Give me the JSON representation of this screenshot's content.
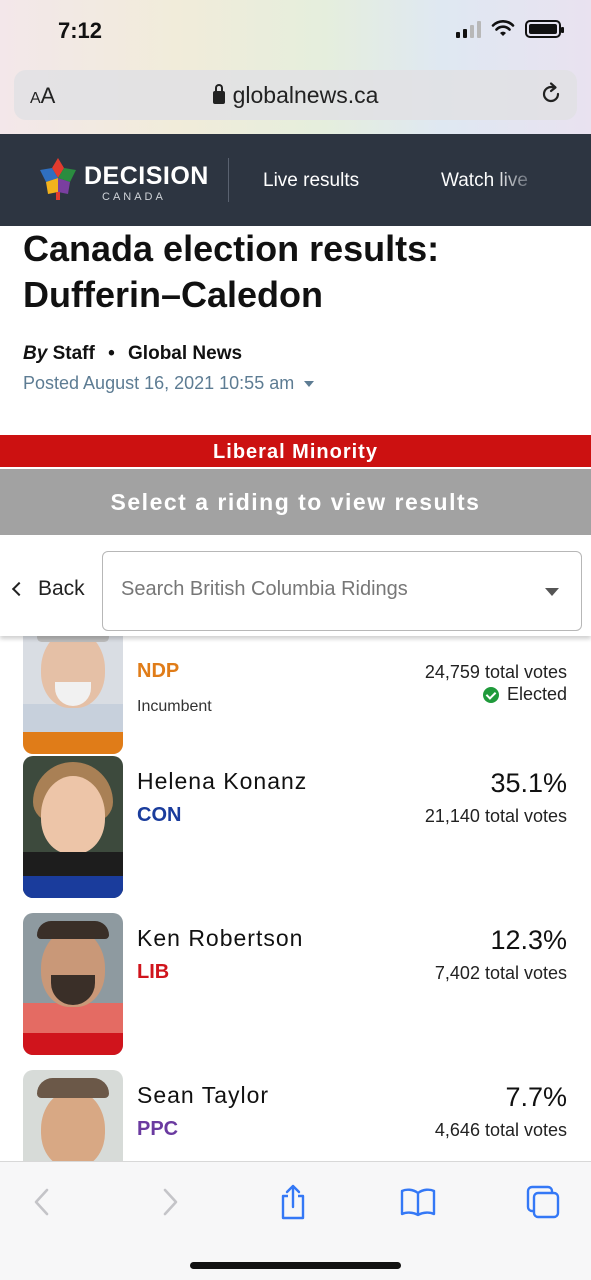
{
  "status_bar": {
    "time": "7:12"
  },
  "browser": {
    "text_size_label": "AA",
    "url": "globalnews.ca"
  },
  "nav": {
    "logo_word": "DECISION",
    "logo_sub": "CANADA",
    "live_results": "Live results",
    "watch_live": "Watch live"
  },
  "article": {
    "headline": "Canada election results: Dufferin–Caledon",
    "by_prefix": "By",
    "author": "Staff",
    "outlet": "Global News",
    "posted": "Posted August 16, 2021 10:55 am"
  },
  "banner": {
    "result": "Liberal Minority",
    "select_prompt": "Select a riding to view results"
  },
  "search": {
    "back_label": "Back",
    "placeholder": "Search British Columbia Ridings"
  },
  "candidates": [
    {
      "name": "",
      "party": "NDP",
      "party_color": "#e07c18",
      "percent": "",
      "votes": "24,759 total votes",
      "incumbent": "Incumbent",
      "status": "Elected"
    },
    {
      "name": "Helena Konanz",
      "party": "CON",
      "party_color": "#1a3c9c",
      "percent": "35.1%",
      "votes": "21,140 total votes"
    },
    {
      "name": "Ken Robertson",
      "party": "LIB",
      "party_color": "#d0141c",
      "percent": "12.3%",
      "votes": "7,402 total votes"
    },
    {
      "name": "Sean Taylor",
      "party": "PPC",
      "party_color": "#6a3aa0",
      "percent": "7.7%",
      "votes": "4,646 total votes"
    }
  ],
  "colors": {
    "nav_bg": "#2d3541",
    "banner_red": "#cc1111",
    "banner_gray": "#a2a2a2",
    "link_gray_blue": "#5d7c93",
    "safari_blue": "#3478f6"
  },
  "icons": {
    "lock": "lock-icon",
    "reload": "reload-icon",
    "back": "chevron-left-icon",
    "forward": "chevron-right-icon",
    "share": "share-icon",
    "bookmarks": "book-icon",
    "tabs": "tabs-icon"
  }
}
